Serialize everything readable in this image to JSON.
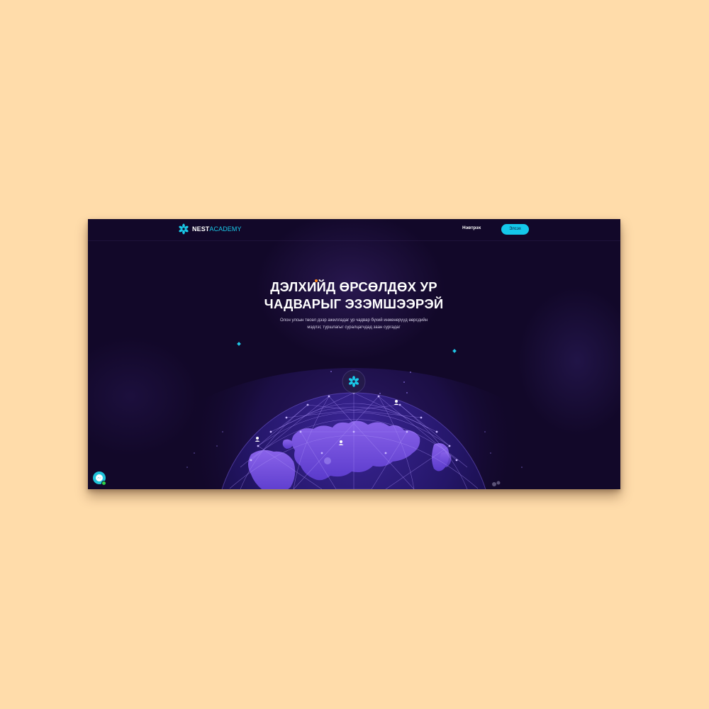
{
  "brand": {
    "name_part1": "NEST",
    "name_part2": "ACADEMY",
    "logo_icon": "nest-flower-icon",
    "accent_color": "#19c9e8"
  },
  "nav": {
    "login_label": "Нэвтрэх",
    "signup_label": "Элсэх"
  },
  "hero": {
    "title_line1": "ДЭЛХИЙД ӨРСӨЛДӨХ УР",
    "title_line2": "ЧАДВАРЫГ ЭЗЭМШЭЭРЭЙ",
    "subtitle_line1": "Олон улсын төсөл дээр ажилладаг ур чадвар бүхий инженерүүд өөрсдийн",
    "subtitle_line2": "мэдлэг, туршлагыг суралцагчдад заан сургадаг"
  },
  "globe": {
    "center_icon": "nest-flower-icon",
    "user_markers": [
      "user-icon",
      "user-icon",
      "user-icon"
    ]
  },
  "chat": {
    "icon": "messenger-icon",
    "status_color": "#2fd34a"
  },
  "colors": {
    "background": "#120829",
    "globe_land": "#6d49d9",
    "button": "#14c8ea",
    "title_dot": "#ff8a1e"
  }
}
